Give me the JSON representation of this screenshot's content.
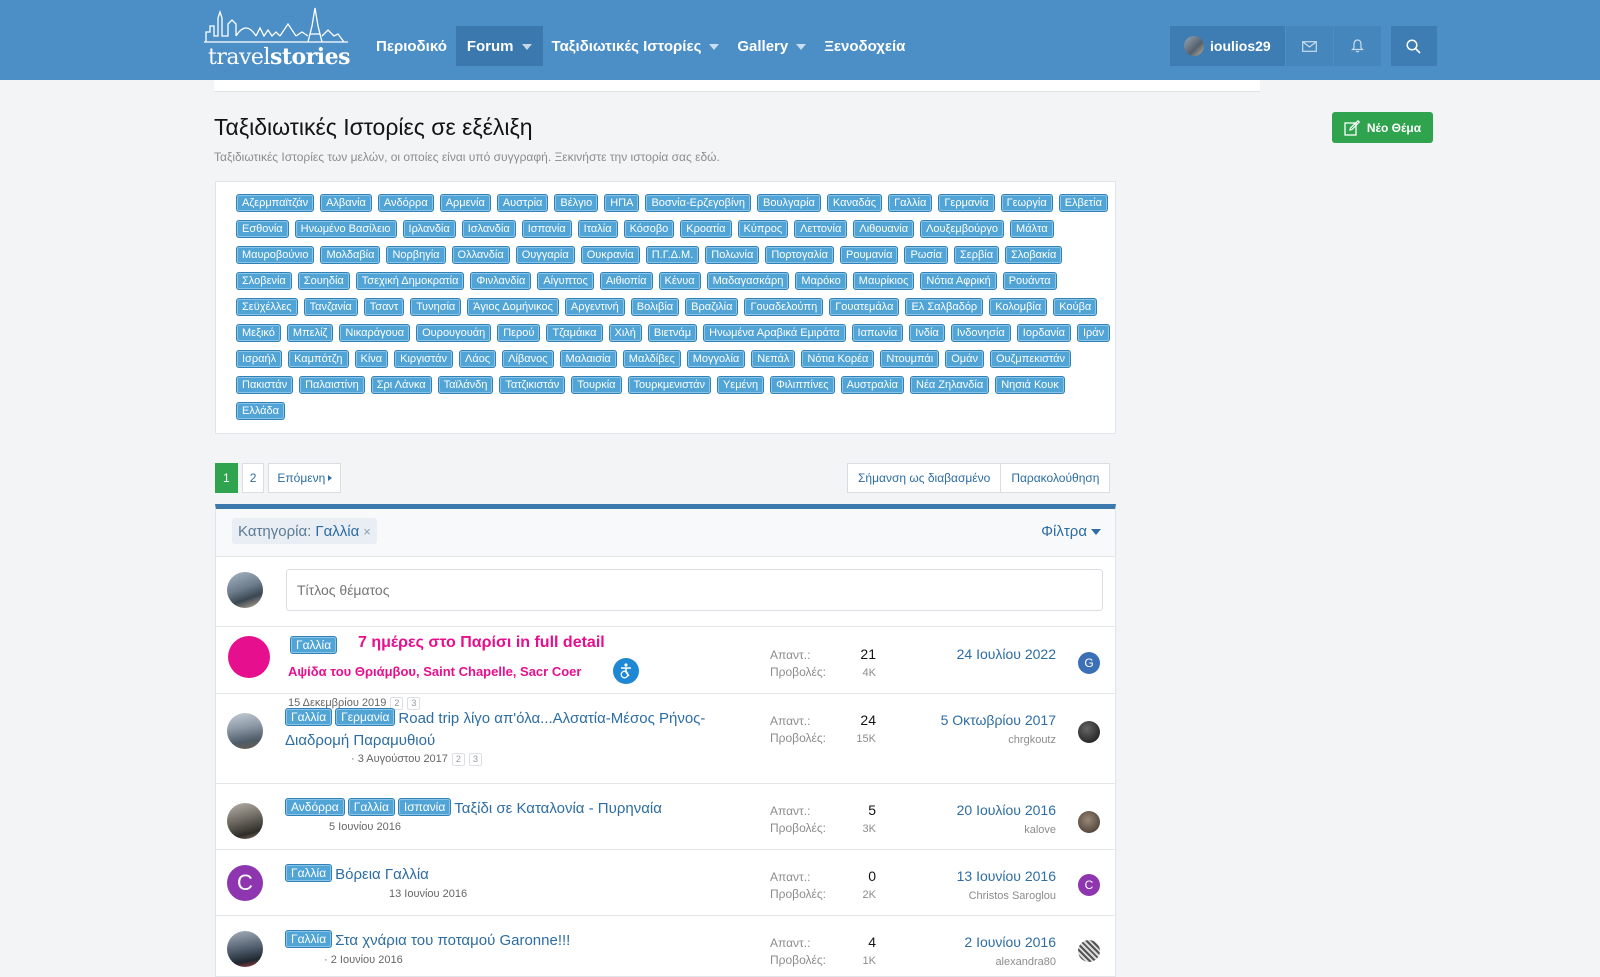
{
  "brand": {
    "logo_text_light": "travel",
    "logo_text_bold": "stories"
  },
  "nav": {
    "items": [
      {
        "label": "Περιοδικό"
      },
      {
        "label": "Forum"
      },
      {
        "label": "Ταξιδιωτικές Ιστορίες"
      },
      {
        "label": "Gallery"
      },
      {
        "label": "Ξενοδοχεία"
      }
    ]
  },
  "user": {
    "name": "ioulios29"
  },
  "icons": {
    "mail": "envelope-icon",
    "alerts": "bell-icon",
    "search": "search-icon",
    "new_thread": "edit-icon"
  },
  "page": {
    "title": "Ταξιδιωτικές Ιστορίες σε εξέλιξη",
    "description": "Ταξιδιωτικές Ιστορίες των μελών, οι οποίες είναι υπό συγγραφή. Ξεκινήστε την ιστορία σας εδώ.",
    "new_thread_label": "Νέο Θέμα"
  },
  "prefixes": [
    "Αζερμπαϊτζάν",
    "Αλβανία",
    "Ανδόρρα",
    "Αρμενία",
    "Αυστρία",
    "Βέλγιο",
    "ΗΠΑ",
    "Βοσνία-Ερζεγοβίνη",
    "Βουλγαρία",
    "Καναδάς",
    "Γαλλία",
    "Γερμανία",
    "Γεωργία",
    "Ελβετία",
    "Εσθονία",
    "Ηνωμένο Βασίλειο",
    "Ιρλανδία",
    "Ισλανδία",
    "Ισπανία",
    "Ιταλία",
    "Κόσοβο",
    "Κροατία",
    "Κύπρος",
    "Λεττονία",
    "Λιθουανία",
    "Λουξεμβούργο",
    "Μάλτα",
    "Μαυροβούνιο",
    "Μολδαβία",
    "Νορβηγία",
    "Ολλανδία",
    "Ουγγαρία",
    "Ουκρανία",
    "Π.Γ.Δ.Μ.",
    "Πολωνία",
    "Πορτογαλία",
    "Ρουμανία",
    "Ρωσία",
    "Σερβία",
    "Σλοβακία",
    "Σλοβενία",
    "Σουηδία",
    "Τσεχική Δημοκρατία",
    "Φινλανδία",
    "Αίγυπτος",
    "Αιθιοπία",
    "Κένυα",
    "Μαδαγασκάρη",
    "Μαρόκο",
    "Μαυρίκιος",
    "Νότια Αφρική",
    "Ρουάντα",
    "Σεϋχέλλες",
    "Τανζανία",
    "Τσαντ",
    "Τυνησία",
    "Άγιος Δομήνικος",
    "Αργεντινή",
    "Βολιβία",
    "Βραζιλία",
    "Γουαδελούπη",
    "Γουατεμάλα",
    "Ελ Σαλβαδόρ",
    "Κολομβία",
    "Κούβα",
    "Μεξικό",
    "Μπελίζ",
    "Νικαράγουα",
    "Ουρουγουάη",
    "Περού",
    "Τζαμάικα",
    "Χιλή",
    "Βιετνάμ",
    "Ηνωμένα Αραβικά Εμιράτα",
    "Ιαπωνία",
    "Ινδία",
    "Ινδονησία",
    "Ιορδανία",
    "Ιράν",
    "Ισραήλ",
    "Καμπότζη",
    "Κίνα",
    "Κιργιστάν",
    "Λάος",
    "Λίβανος",
    "Μαλαισία",
    "Μαλδίβες",
    "Μογγολία",
    "Νεπάλ",
    "Νότια Κορέα",
    "Ντουμπάι",
    "Ομάν",
    "Ουζμπεκιστάν",
    "Πακιστάν",
    "Παλαιστίνη",
    "Σρι Λάνκα",
    "Ταϊλάνδη",
    "Τατζικιστάν",
    "Τουρκία",
    "Τουρκμενιστάν",
    "Υεμένη",
    "Φιλιππίνες",
    "Αυστραλία",
    "Νέα Ζηλανδία",
    "Νησιά Κουκ",
    "Ελλάδα"
  ],
  "pagination": {
    "pages": [
      "1",
      "2"
    ],
    "current": "1",
    "next_label": "Επόμενη"
  },
  "actions": {
    "mark_read": "Σήμανση ως διαβασμένο",
    "watch": "Παρακολούθηση"
  },
  "filter": {
    "label": "Κατηγορία:",
    "value": "Γαλλία",
    "remove": "×",
    "filters_label": "Φίλτρα"
  },
  "quick_thread": {
    "placeholder": "Τίτλος θέματος"
  },
  "stats_labels": {
    "replies": "Απαντ.:",
    "views": "Προβολές:"
  },
  "threads": [
    {
      "prefixes": [
        "Γαλλία"
      ],
      "title": "7 ημέρες στο Παρίσι in full detail",
      "subtitle": "Αψίδα του Θριάμβου, Saint Chapelle, Sacr Coer",
      "started": "15 Δεκεμβρίου 2019",
      "pages": [
        "2",
        "3"
      ],
      "replies": "21",
      "views": "4K",
      "last_date": "24 Ιουλίου 2022",
      "last_user": "",
      "last_avatar_letter": "G",
      "last_avatar_color": "#3b6fb6",
      "avatar_color": "#e60f8e"
    },
    {
      "prefixes": [
        "Γαλλία",
        "Γερμανία"
      ],
      "title": "Road trip λίγο απ'όλα...Αλσατία-Μέσος Ρήνος-Διαδρομή Παραμυθιού",
      "started": "· 3 Αυγούστου 2017",
      "pages": [
        "2",
        "3"
      ],
      "replies": "24",
      "views": "15K",
      "last_date": "5 Οκτωβρίου 2017",
      "last_user": "chrgkoutz"
    },
    {
      "prefixes": [
        "Ανδόρρα",
        "Γαλλία",
        "Ισπανία"
      ],
      "title": "Ταξίδι σε Καταλονία - Πυρηναία",
      "started": "5 Ιουνίου 2016",
      "replies": "5",
      "views": "3K",
      "last_date": "20 Ιουλίου 2016",
      "last_user": "kalove"
    },
    {
      "prefixes": [
        "Γαλλία"
      ],
      "title": "Βόρεια Γαλλία",
      "started": "13 Ιουνίου 2016",
      "replies": "0",
      "views": "2K",
      "last_date": "13 Ιουνίου 2016",
      "last_user": "Christos Saroglou",
      "avatar_letter": "C",
      "avatar_color": "#8e35b0",
      "last_avatar_letter": "C",
      "last_avatar_color": "#8e35b0"
    },
    {
      "prefixes": [
        "Γαλλία"
      ],
      "title": "Στα χνάρια του ποταμού Garonne!!!",
      "started": "· 2 Ιουνίου 2016",
      "replies": "4",
      "views": "1K",
      "last_date": "2 Ιουνίου 2016",
      "last_user": "alexandra80"
    }
  ],
  "colors": {
    "header": "#4b8fc6",
    "accent": "#2fa34d",
    "link": "#2d6da3",
    "tag": "#51a4d6",
    "pink": "#e60f8e"
  }
}
